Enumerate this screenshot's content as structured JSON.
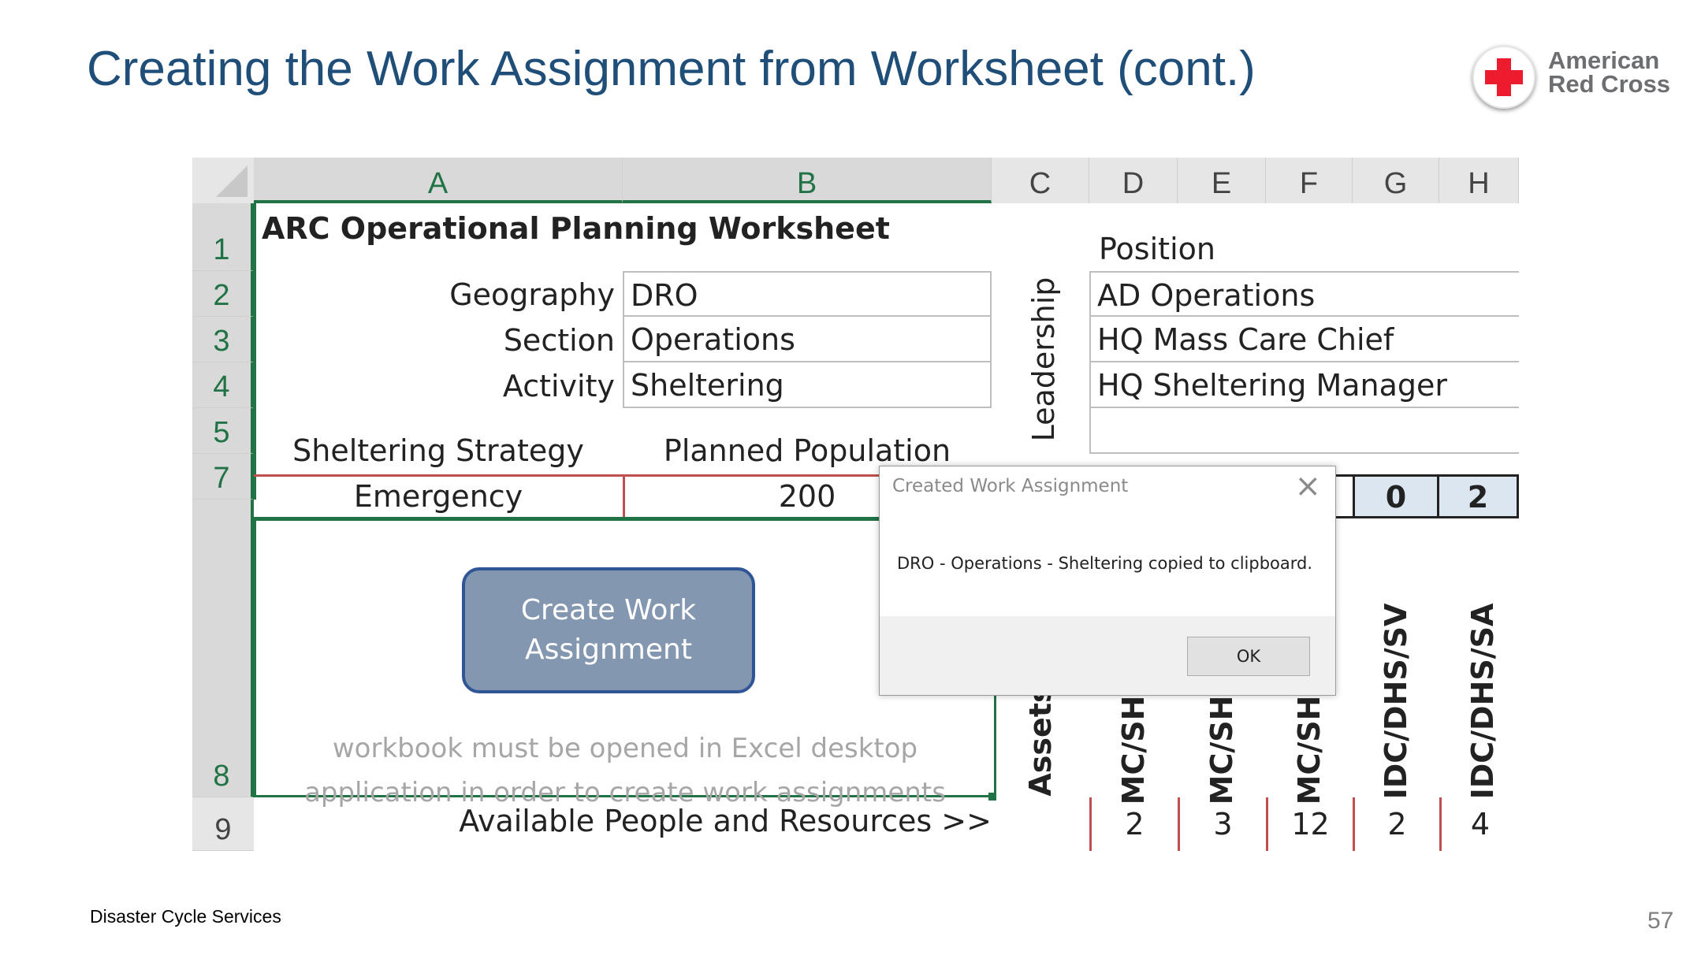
{
  "slide": {
    "title": "Creating the Work Assignment from Worksheet (cont.)",
    "footer": "Disaster Cycle Services",
    "page_number": "57",
    "logo": {
      "line1": "American",
      "line2": "Red Cross",
      "icon": "red-cross-icon"
    }
  },
  "sheet": {
    "columns": [
      "A",
      "B",
      "C",
      "D",
      "E",
      "F",
      "G",
      "H"
    ],
    "rows": [
      "1",
      "2",
      "3",
      "4",
      "5",
      "7",
      "8",
      "9"
    ],
    "title": "ARC Operational Planning Worksheet",
    "labels": {
      "geography": "Geography",
      "section": "Section",
      "activity": "Activity"
    },
    "values": {
      "geography": "DRO",
      "section": "Operations",
      "activity": "Sheltering"
    },
    "strategy_header": "Sheltering Strategy",
    "population_header": "Planned Population",
    "strategy_value": "Emergency",
    "population_value": "200",
    "position_header": "Position",
    "leadership_label": "Leadership",
    "positions": [
      "AD Operations",
      "HQ Mass Care Chief",
      "HQ Sheltering Manager",
      ""
    ],
    "row7_values": {
      "g": "0",
      "h": "2"
    },
    "create_button": "Create Work\nAssignment",
    "note": "workbook must be opened in Excel desktop\napplication in order to create work assignments",
    "vertical_headers": [
      "Assets",
      "MC/SH/",
      "MC/SH/",
      "MC/SH/",
      "IDC/DHS/SV",
      "IDC/DHS/SA"
    ],
    "available_label": "Available People and Resources >>",
    "available_values": [
      "",
      "2",
      "3",
      "12",
      "2",
      "4"
    ]
  },
  "dialog": {
    "title": "Created Work Assignment",
    "message": "DRO - Operations - Sheltering copied to clipboard.",
    "ok_label": "OK",
    "close_icon": "close-icon"
  }
}
